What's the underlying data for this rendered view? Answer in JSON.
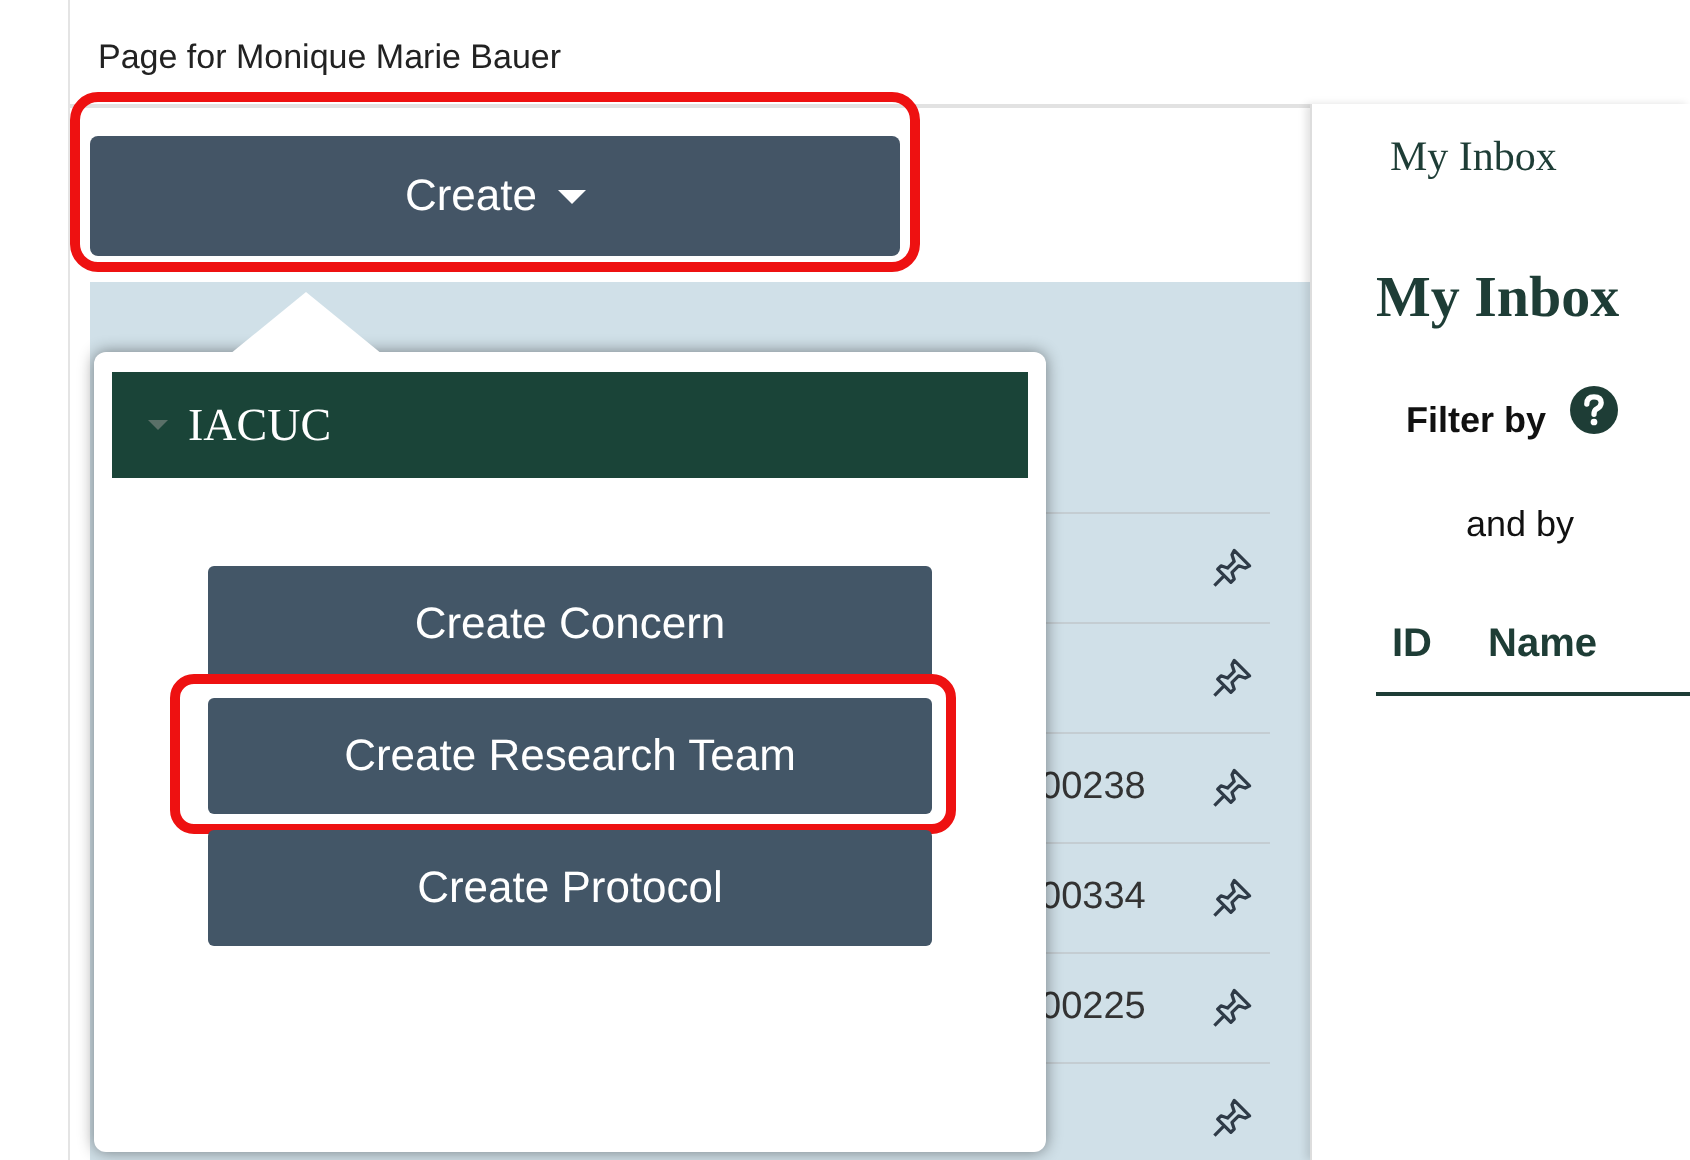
{
  "page_title": "Page for Monique Marie Bauer",
  "create_button": {
    "label": "Create",
    "highlighted": true
  },
  "recent_list": {
    "rows": [
      {},
      {},
      {
        "text": "00238"
      },
      {
        "text": "00334"
      },
      {
        "text": "00225"
      },
      {}
    ]
  },
  "create_menu": {
    "group": "IACUC",
    "expanded": true,
    "items": [
      {
        "label": "Create Concern",
        "highlighted": false
      },
      {
        "label": "Create Research Team",
        "highlighted": true
      },
      {
        "label": "Create Protocol",
        "highlighted": false
      }
    ]
  },
  "inbox": {
    "tab": "My Inbox",
    "heading": "My Inbox",
    "filter_label": "Filter by",
    "and_by": "and by",
    "columns": [
      "ID",
      "Name"
    ]
  }
}
